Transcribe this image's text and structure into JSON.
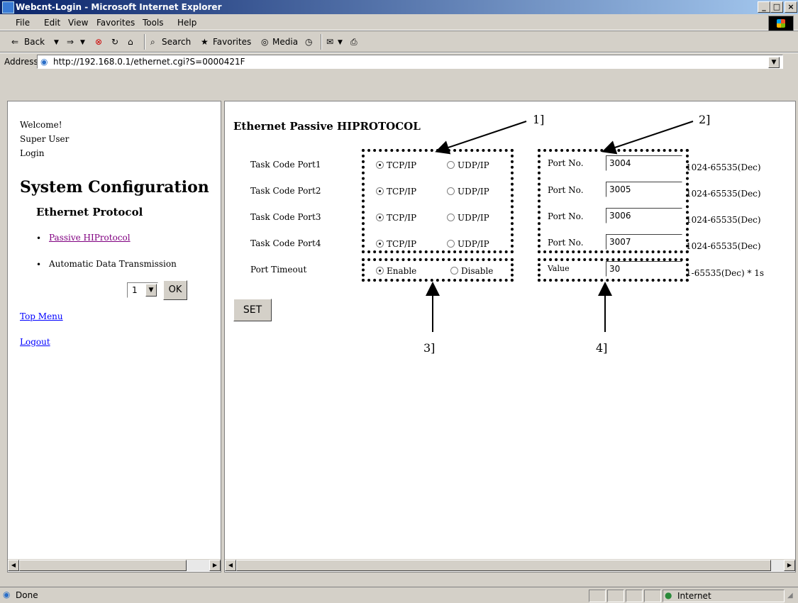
{
  "window": {
    "title": "Webcnt-Login - Microsoft Internet Explorer",
    "min": "_",
    "max": "□",
    "close": "×"
  },
  "menu": [
    "File",
    "Edit",
    "View",
    "Favorites",
    "Tools",
    "Help"
  ],
  "toolbar": {
    "back": "Back",
    "search": "Search",
    "favorites": "Favorites",
    "media": "Media"
  },
  "address": {
    "label": "Address",
    "url": "http://192.168.0.1/ethernet.cgi?S=0000421F"
  },
  "left": {
    "welcome": "Welcome!",
    "user": "Super User",
    "login": "Login",
    "heading": "System Configuration",
    "subheading": "Ethernet Protocol",
    "nav": [
      {
        "label": "Passive HIProtocol"
      },
      {
        "label": "Automatic Data Transmission"
      }
    ],
    "select_value": "1",
    "ok_label": "OK",
    "top_menu": "Top Menu",
    "logout": "Logout"
  },
  "main": {
    "title": "Ethernet Passive HIPROTOCOL",
    "rows": [
      {
        "label": "Task Code Port1",
        "opt1": "TCP/IP",
        "opt2": "UDP/IP",
        "port_label": "Port No.",
        "value": "3004",
        "range": "1024-65535(Dec)"
      },
      {
        "label": "Task Code Port2",
        "opt1": "TCP/IP",
        "opt2": "UDP/IP",
        "port_label": "Port No.",
        "value": "3005",
        "range": "1024-65535(Dec)"
      },
      {
        "label": "Task Code Port3",
        "opt1": "TCP/IP",
        "opt2": "UDP/IP",
        "port_label": "Port No.",
        "value": "3006",
        "range": "1024-65535(Dec)"
      },
      {
        "label": "Task Code Port4",
        "opt1": "TCP/IP",
        "opt2": "UDP/IP",
        "port_label": "Port No.",
        "value": "3007",
        "range": "1024-65535(Dec)"
      }
    ],
    "timeout": {
      "label": "Port Timeout",
      "opt1": "Enable",
      "opt2": "Disable",
      "value_label": "Value",
      "value": "30",
      "range": "1-65535(Dec) * 1s"
    },
    "set_label": "SET",
    "callouts": [
      "1]",
      "2]",
      "3]",
      "4]"
    ]
  },
  "status": {
    "text": "Done",
    "zone": "Internet"
  }
}
